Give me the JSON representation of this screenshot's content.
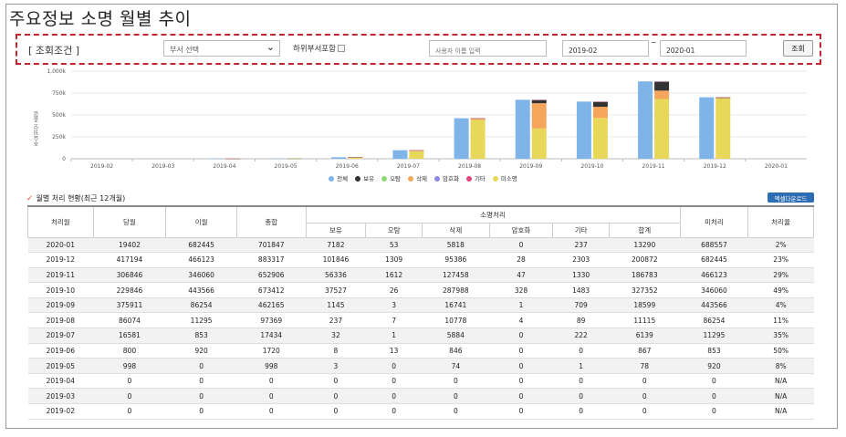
{
  "page": {
    "title": "주요정보 소명 월별 추이"
  },
  "search": {
    "condition_label": "[ 조회조건 ]",
    "dept_select_value": "부서 선택",
    "sub_dept_label": "하위부서포함",
    "name_placeholder": "사용자 이름 입력",
    "date_from": "2019-02",
    "date_sep": "~",
    "date_to": "2020-01",
    "search_button": "조회"
  },
  "chart_data": {
    "type": "bar",
    "title": "",
    "ylabel": "주요정보 총합",
    "yticks": [
      "0",
      "250k",
      "500k",
      "750k",
      "1,000k"
    ],
    "ylim": [
      0,
      1000000
    ],
    "categories": [
      "2019-02",
      "2019-03",
      "2019-04",
      "2019-05",
      "2019-06",
      "2019-07",
      "2019-08",
      "2019-09",
      "2019-10",
      "2019-11",
      "2019-12",
      "2020-01"
    ],
    "series": [
      {
        "name": "전체",
        "color": "#7fb4e8",
        "stack": "total",
        "values": [
          0,
          0,
          998,
          1720,
          17434,
          97369,
          462165,
          673412,
          652906,
          883317,
          701847,
          0
        ]
      },
      {
        "name": "보유",
        "color": "#333333",
        "stack": "detail",
        "values": [
          0,
          0,
          3,
          8,
          32,
          237,
          1145,
          37527,
          56336,
          101846,
          7182,
          0
        ]
      },
      {
        "name": "오탐",
        "color": "#8fd97a",
        "stack": "detail",
        "values": [
          0,
          0,
          0,
          13,
          1,
          7,
          3,
          26,
          1612,
          1309,
          53,
          0
        ]
      },
      {
        "name": "삭제",
        "color": "#f5a55c",
        "stack": "detail",
        "values": [
          0,
          0,
          74,
          846,
          5884,
          10778,
          16741,
          287988,
          127458,
          95386,
          5818,
          0
        ]
      },
      {
        "name": "암호화",
        "color": "#8a8ae0",
        "stack": "detail",
        "values": [
          0,
          0,
          0,
          0,
          0,
          4,
          1,
          328,
          47,
          28,
          0,
          0
        ]
      },
      {
        "name": "기타",
        "color": "#e2497a",
        "stack": "detail",
        "values": [
          0,
          0,
          1,
          0,
          222,
          89,
          709,
          1483,
          1330,
          2303,
          237,
          0
        ]
      },
      {
        "name": "미소명",
        "color": "#e8d85a",
        "stack": "detail",
        "values": [
          0,
          0,
          920,
          853,
          11295,
          86254,
          443566,
          346060,
          466123,
          682445,
          688557,
          0
        ]
      }
    ]
  },
  "legend_items": [
    {
      "label": "전체",
      "color": "#7fb4e8"
    },
    {
      "label": "보유",
      "color": "#333333"
    },
    {
      "label": "오탐",
      "color": "#8fd97a"
    },
    {
      "label": "삭제",
      "color": "#f5a55c"
    },
    {
      "label": "암호화",
      "color": "#8a8ae0"
    },
    {
      "label": "기타",
      "color": "#e2497a"
    },
    {
      "label": "미소명",
      "color": "#e8d85a"
    }
  ],
  "section": {
    "title": "월별 처리 현황(최근 12개월)",
    "excel_button": "엑셀다운로드"
  },
  "table": {
    "headers": {
      "month": "처리월",
      "current": "당월",
      "carry": "이월",
      "total": "총합",
      "group": "소명처리",
      "sub": [
        "보유",
        "오탐",
        "삭제",
        "암호화",
        "기타",
        "합계"
      ],
      "unprocessed": "미처리",
      "rate": "처리율"
    },
    "rows": [
      [
        "2020-01",
        "19402",
        "682445",
        "701847",
        "7182",
        "53",
        "5818",
        "0",
        "237",
        "13290",
        "688557",
        "2%"
      ],
      [
        "2019-12",
        "417194",
        "466123",
        "883317",
        "101846",
        "1309",
        "95386",
        "28",
        "2303",
        "200872",
        "682445",
        "23%"
      ],
      [
        "2019-11",
        "306846",
        "346060",
        "652906",
        "56336",
        "1612",
        "127458",
        "47",
        "1330",
        "186783",
        "466123",
        "29%"
      ],
      [
        "2019-10",
        "229846",
        "443566",
        "673412",
        "37527",
        "26",
        "287988",
        "328",
        "1483",
        "327352",
        "346060",
        "49%"
      ],
      [
        "2019-09",
        "375911",
        "86254",
        "462165",
        "1145",
        "3",
        "16741",
        "1",
        "709",
        "18599",
        "443566",
        "4%"
      ],
      [
        "2019-08",
        "86074",
        "11295",
        "97369",
        "237",
        "7",
        "10778",
        "4",
        "89",
        "11115",
        "86254",
        "11%"
      ],
      [
        "2019-07",
        "16581",
        "853",
        "17434",
        "32",
        "1",
        "5884",
        "0",
        "222",
        "6139",
        "11295",
        "35%"
      ],
      [
        "2019-06",
        "800",
        "920",
        "1720",
        "8",
        "13",
        "846",
        "0",
        "0",
        "867",
        "853",
        "50%"
      ],
      [
        "2019-05",
        "998",
        "0",
        "998",
        "3",
        "0",
        "74",
        "0",
        "1",
        "78",
        "920",
        "8%"
      ],
      [
        "2019-04",
        "0",
        "0",
        "0",
        "0",
        "0",
        "0",
        "0",
        "0",
        "0",
        "0",
        "N/A"
      ],
      [
        "2019-03",
        "0",
        "0",
        "0",
        "0",
        "0",
        "0",
        "0",
        "0",
        "0",
        "0",
        "N/A"
      ],
      [
        "2019-02",
        "0",
        "0",
        "0",
        "0",
        "0",
        "0",
        "0",
        "0",
        "0",
        "0",
        "N/A"
      ]
    ]
  }
}
